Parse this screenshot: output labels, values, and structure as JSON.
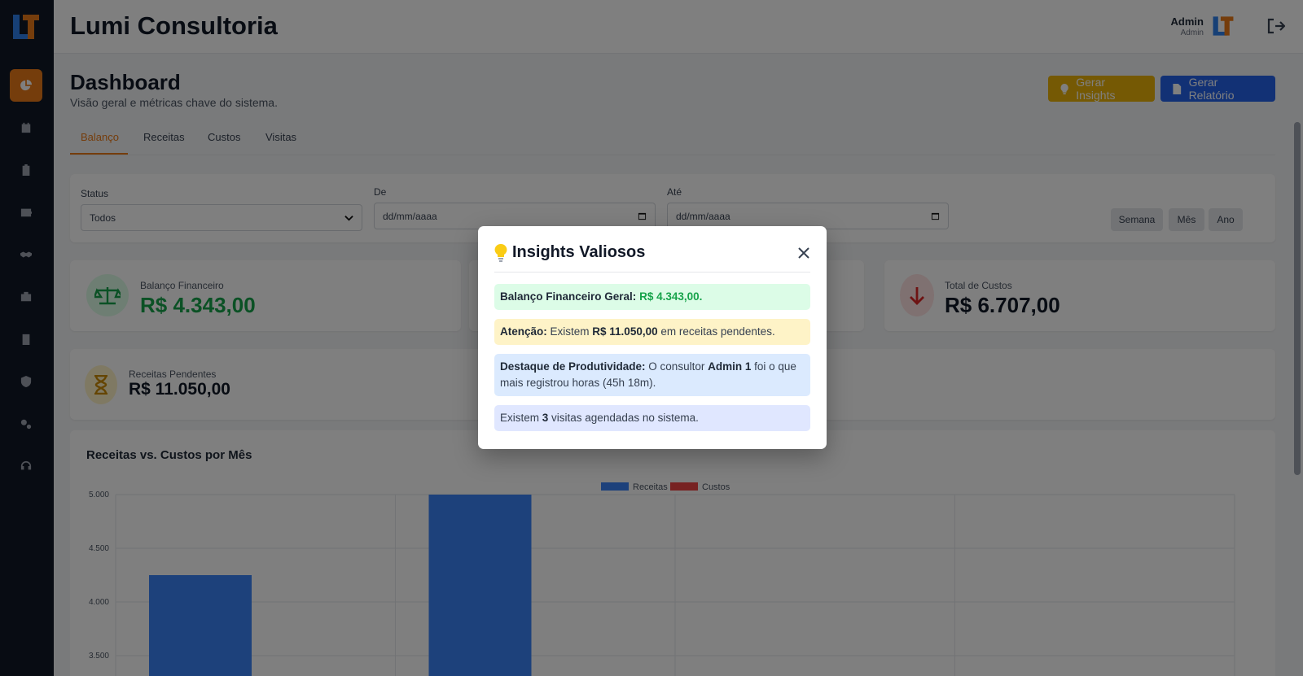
{
  "app": {
    "brand": "Lumi Consultoria",
    "user_name": "Admin",
    "user_role": "Admin"
  },
  "sidebar": {
    "items": [
      {
        "icon": "pie-chart-icon",
        "active": true
      },
      {
        "icon": "calendar-icon"
      },
      {
        "icon": "clipboard-icon"
      },
      {
        "icon": "wallet-icon"
      },
      {
        "icon": "handshake-icon"
      },
      {
        "icon": "briefcase-icon"
      },
      {
        "icon": "building-icon"
      },
      {
        "icon": "shield-icon"
      },
      {
        "icon": "gears-icon"
      },
      {
        "icon": "headset-icon"
      }
    ]
  },
  "page": {
    "title": "Dashboard",
    "subtitle": "Visão geral e métricas chave do sistema.",
    "insights_button": "Gerar Insights",
    "report_button": "Gerar Relatório"
  },
  "tabs": [
    "Balanço",
    "Receitas",
    "Custos",
    "Visitas"
  ],
  "filters": {
    "status_label": "Status",
    "status_value": "Todos",
    "from_label": "De",
    "from_placeholder": "dd/mm/aaaa",
    "to_label": "Até",
    "to_placeholder": "dd/mm/aaaa",
    "period_buttons": [
      "Semana",
      "Mês",
      "Ano"
    ]
  },
  "cards": {
    "balance_label": "Balanço Financeiro",
    "balance_value": "R$ 4.343,00",
    "costs_label": "Total de Custos",
    "costs_value": "R$ 6.707,00",
    "pending_label": "Receitas Pendentes",
    "pending_value": "R$ 11.050,00"
  },
  "chart_data": {
    "type": "bar",
    "title": "Receitas vs. Custos por Mês",
    "categories": [
      "",
      "",
      "",
      ""
    ],
    "series": [
      {
        "name": "Receitas",
        "values": [
          4250,
          5000,
          null,
          null
        ]
      },
      {
        "name": "Custos",
        "values": [
          null,
          null,
          null,
          null
        ]
      }
    ],
    "y_ticks": [
      "5.000",
      "4.500",
      "4.000",
      "3.500"
    ],
    "ylim": [
      3500,
      5000
    ],
    "legend": "top-center",
    "colors": {
      "Receitas": "#3b82f6",
      "Custos": "#ef4444"
    }
  },
  "modal": {
    "title": "Insights Valiosos",
    "insights": {
      "balance_prefix": "Balanço Financeiro Geral:",
      "balance_value": "R$ 4.343,00",
      "balance_suffix": ".",
      "attention_prefix": "Atenção:",
      "attention_text1": " Existem ",
      "attention_value": "R$ 11.050,00",
      "attention_text2": " em receitas pendentes.",
      "productivity_prefix": "Destaque de Produtividade:",
      "productivity_text1": " O consultor ",
      "productivity_name": "Admin 1",
      "productivity_text2": " foi o que mais registrou horas (45h 18m).",
      "visits_text1": "Existem ",
      "visits_count": "3",
      "visits_text2": " visitas agendadas no sistema."
    }
  },
  "colors": {
    "accent": "#ea7b18",
    "sidebar_bg": "#111827",
    "insights_btn": "#eab308",
    "report_btn": "#2563eb"
  }
}
